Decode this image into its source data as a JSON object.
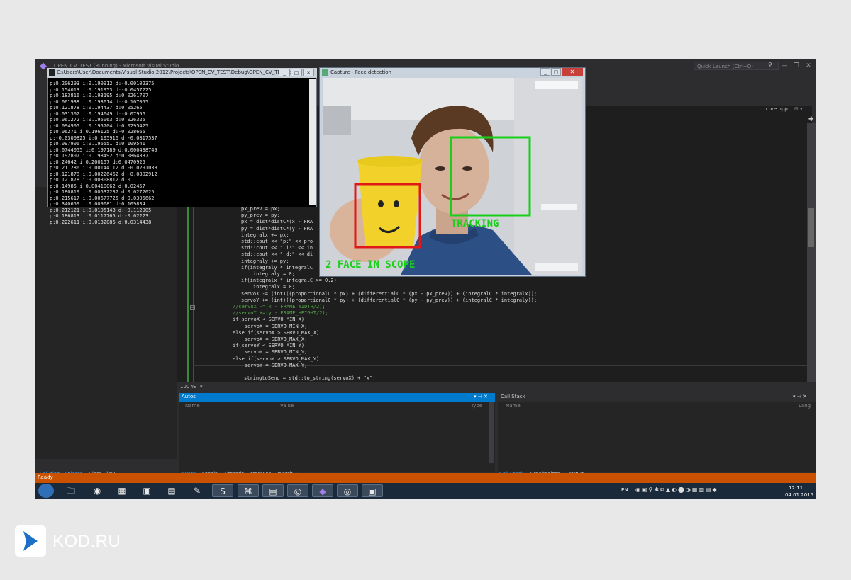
{
  "vs": {
    "title": "OPEN_CV_TEST (Running) - Microsoft Visual Studio",
    "quick_launch_placeholder": "Quick Launch (Ctrl+Q)",
    "file_tab": "core.hpp",
    "zoom": "100 %",
    "status": "Ready"
  },
  "console": {
    "title": "C:\\Users\\User\\Documents\\Visual Studio 2012\\Projects\\OPEN_CV_TEST\\Debug\\OPEN_CV_TEST.exe",
    "lines": [
      "p:0.206293 i:0.190912 d:-0.00102375",
      "p:0.154013 i:0.191953 d:-0.0457225",
      "p:0.183816 i:0.193195 d:0.0261707",
      "p:0.061938 i:0.193614 d:-0.107055",
      "p:0.121878 i:0.194437 d:0.05265",
      "p:0.031302 i:0.194649 d:-0.07956",
      "p:0.061272 i:0.195063 d:0.026325",
      "p:0.094905 i:0.195704 d:0.0295425",
      "p:0.06271 i:0.196125 d:-0.028665",
      "p:-0.0300825 i:0.195916 d:-0.0817537",
      "p:0.097906 i:0.196551 d:0.109541",
      "p:0.0744055 i:0.197189 d:0.000438749",
      "p:0.192807 i:0.198492 d:0.0864337",
      "p:0.24642 i:0.200157 d:0.0470925",
      "p:0.211286 i:0.00144112 d:-0.0291038",
      "p:0.121878 i:0.00226462 d:-0.0802912",
      "p:0.121878 i:0.00308812 d:0",
      "p:0.14985 i:0.00410062 d:0.02457",
      "p:0.180819 i:0.00532237 d:0.0272025",
      "p:0.215617 i:0.00677725 d:0.0305662",
      "p:0.340659 i:0.009081 d:0.109834",
      "p:0.212121 i:0.0105143 d:-0.112905",
      "p:0.186813 i:0.0117765 d:-0.02223",
      "p:0.222611 i:0.0132086 d:0.0314438"
    ]
  },
  "capture": {
    "title": "Capture - Face detection",
    "label_tracking": "TRACKING",
    "label_scope": "2 FACE IN SCOPE"
  },
  "code": {
    "lines": [
      "px_prev = px;",
      "py_prev = py;",
      "px = dist*distC*(x - FRA",
      "py = dist*distC*(y - FRA",
      "integralx += px;",
      "std::cout << \"p:\" << pro",
      "std::cout << \" i:\" << in",
      "std::cout << \" d:\" << di",
      "integraly += py;",
      "if(integraly * integralC",
      "    integraly = 0;",
      "if(integralx * integralC >= 0.2)",
      "    integralx = 0;",
      "servoX -= (int)((proportionalC * px) + (differentialC * (px - px_prev)) + (integralC * integralx));",
      "servoY += (int)((proportionalC * py) + (differentialC * (py - py_prev)) + (integralC * integraly));",
      "//servoX -=(x - FRAME_WIDTH/2);",
      "//servoY +=(y - FRAME_HEIGHT/2);",
      "if(servoX < SERVO_MIN_X)",
      "    servoX = SERVO_MIN_X;",
      "else if(servoX > SERVO_MAX_X)",
      "    servoX = SERVO_MAX_X;",
      "if(servoY < SERVO_MIN_Y)",
      "    servoY = SERVO_MIN_Y;",
      "else if(servoY > SERVO_MAX_Y)",
      "    servoY = SERVO_MAX_Y;",
      "",
      "stringtoSend = std::to_string(servoX) + \"x\";"
    ]
  },
  "autos": {
    "title": "Autos",
    "col_name": "Name",
    "col_value": "Value",
    "col_type": "Type",
    "tabs": [
      "Autos",
      "Locals",
      "Threads",
      "Modules",
      "Watch 1"
    ]
  },
  "callstack": {
    "title": "Call Stack",
    "col_name": "Name",
    "col_lang": "Lang",
    "tabs": [
      "Call Stack",
      "Breakpoints",
      "Output"
    ]
  },
  "solution": {
    "tabs": [
      "Solution Explorer",
      "Class View"
    ]
  },
  "taskbar": {
    "lang": "EN",
    "time": "12:11",
    "date": "04.01.2015"
  },
  "brand": {
    "name": "KOD.RU",
    "accent": "#1e6fc8"
  }
}
